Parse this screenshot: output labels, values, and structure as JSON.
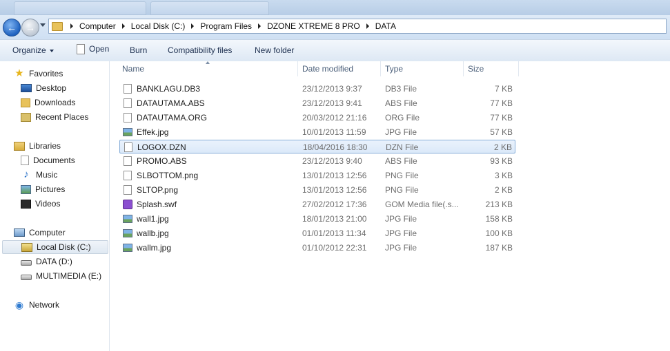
{
  "address": {
    "crumbs": [
      "Computer",
      "Local Disk (C:)",
      "Program Files",
      "DZONE XTREME 8 PRO",
      "DATA"
    ]
  },
  "toolbar": {
    "organize": "Organize",
    "open": "Open",
    "burn": "Burn",
    "compatibility": "Compatibility files",
    "new_folder": "New folder"
  },
  "nav": {
    "favorites": "Favorites",
    "desktop": "Desktop",
    "downloads": "Downloads",
    "recent_places": "Recent Places",
    "libraries": "Libraries",
    "documents": "Documents",
    "music": "Music",
    "pictures": "Pictures",
    "videos": "Videos",
    "computer": "Computer",
    "local_disk": "Local Disk (C:)",
    "data_drive": "DATA (D:)",
    "multimedia_drive": "MULTIMEDIA (E:)",
    "network": "Network"
  },
  "columns": {
    "name": "Name",
    "date_modified": "Date modified",
    "type": "Type",
    "size": "Size"
  },
  "files": [
    {
      "name": "BANKLAGU.DB3",
      "date": "23/12/2013 9:37",
      "type": "DB3 File",
      "size": "7 KB",
      "icon": "blank-file-icon"
    },
    {
      "name": "DATAUTAMA.ABS",
      "date": "23/12/2013 9:41",
      "type": "ABS File",
      "size": "77 KB",
      "icon": "blank-file-icon"
    },
    {
      "name": "DATAUTAMA.ORG",
      "date": "20/03/2012 21:16",
      "type": "ORG File",
      "size": "77 KB",
      "icon": "blank-file-icon"
    },
    {
      "name": "Effek.jpg",
      "date": "10/01/2013 11:59",
      "type": "JPG File",
      "size": "57 KB",
      "icon": "image-file-icon"
    },
    {
      "name": "LOGOX.DZN",
      "date": "18/04/2016 18:30",
      "type": "DZN File",
      "size": "2 KB",
      "icon": "blank-file-icon",
      "selected": true
    },
    {
      "name": "PROMO.ABS",
      "date": "23/12/2013 9:40",
      "type": "ABS File",
      "size": "93 KB",
      "icon": "blank-file-icon"
    },
    {
      "name": "SLBOTTOM.png",
      "date": "13/01/2013 12:56",
      "type": "PNG File",
      "size": "3 KB",
      "icon": "blank-file-icon"
    },
    {
      "name": "SLTOP.png",
      "date": "13/01/2013 12:56",
      "type": "PNG File",
      "size": "2 KB",
      "icon": "blank-file-icon"
    },
    {
      "name": "Splash.swf",
      "date": "27/02/2012 17:36",
      "type": "GOM Media file(.s...",
      "size": "213 KB",
      "icon": "swf-file-icon"
    },
    {
      "name": "wall1.jpg",
      "date": "18/01/2013 21:00",
      "type": "JPG File",
      "size": "158 KB",
      "icon": "image-file-icon"
    },
    {
      "name": "wallb.jpg",
      "date": "01/01/2013 11:34",
      "type": "JPG File",
      "size": "100 KB",
      "icon": "image-file-icon"
    },
    {
      "name": "wallm.jpg",
      "date": "01/10/2012 22:31",
      "type": "JPG File",
      "size": "187 KB",
      "icon": "image-file-icon"
    }
  ]
}
